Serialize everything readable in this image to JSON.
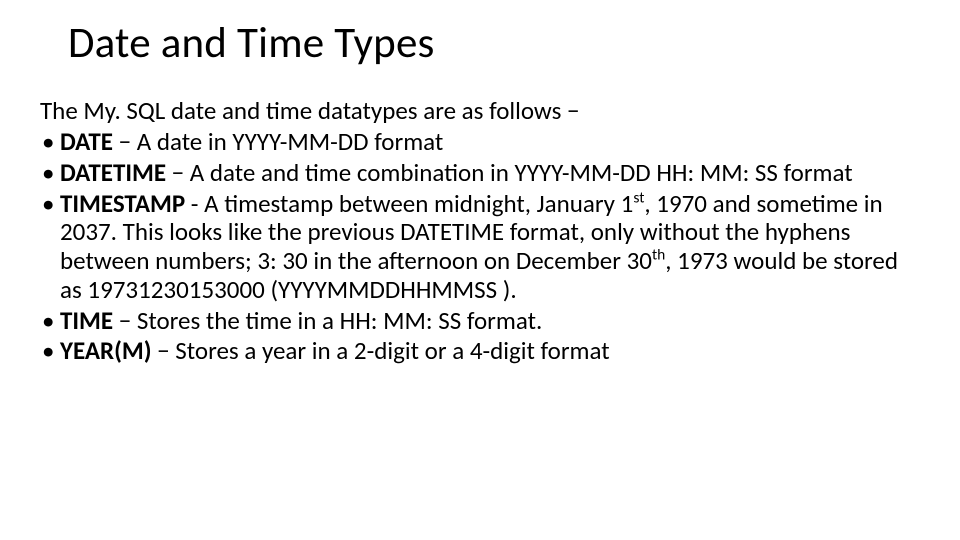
{
  "title": "Date and Time Types",
  "intro": "The My. SQL date and time datatypes are as follows −",
  "items": [
    {
      "bold": "DATE",
      "text": " − A date in YYYY-MM-DD format"
    },
    {
      "bold": "DATETIME",
      "text": " − A date and time combination in YYYY-MM-DD HH: MM: SS format"
    },
    {
      "bold": "TIMESTAMP",
      "text_prefix": " - A timestamp between midnight, January 1",
      "sup1": "st",
      "text_mid": ", 1970 and sometime in 2037. This looks like the previous DATETIME format, only without the hyphens between numbers; 3: 30 in the afternoon on December 30",
      "sup2": "th",
      "text_suffix": ", 1973 would be stored as 19731230153000 (YYYYMMDDHHMMSS )."
    },
    {
      "bold": "TIME",
      "text": " − Stores the time in a HH: MM: SS format."
    },
    {
      "bold": "YEAR(M)",
      "text": " − Stores a year in a 2-digit or a 4-digit format"
    }
  ]
}
